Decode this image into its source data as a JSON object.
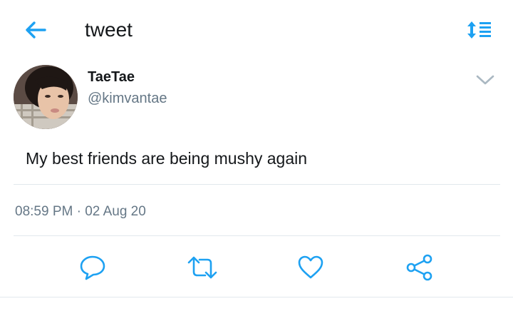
{
  "header": {
    "title": "tweet",
    "back_icon": "arrow-left-icon",
    "sort_icon": "sort-list-icon",
    "accent_color": "#1da1f2"
  },
  "tweet": {
    "author": {
      "name": "TaeTae",
      "handle": "@kimvantae",
      "avatar": "avatar-photo"
    },
    "menu_icon": "chevron-down-icon",
    "text": "My best friends are being mushy again",
    "timestamp": "08:59 PM · 02 Aug 20"
  },
  "actions": {
    "reply_icon": "reply-bubble-icon",
    "retweet_icon": "retweet-icon",
    "like_icon": "heart-icon",
    "share_icon": "share-icon",
    "icon_color": "#1da1f2"
  },
  "colors": {
    "text_primary": "#14171a",
    "text_secondary": "#657786",
    "divider": "#e1e8ed"
  }
}
